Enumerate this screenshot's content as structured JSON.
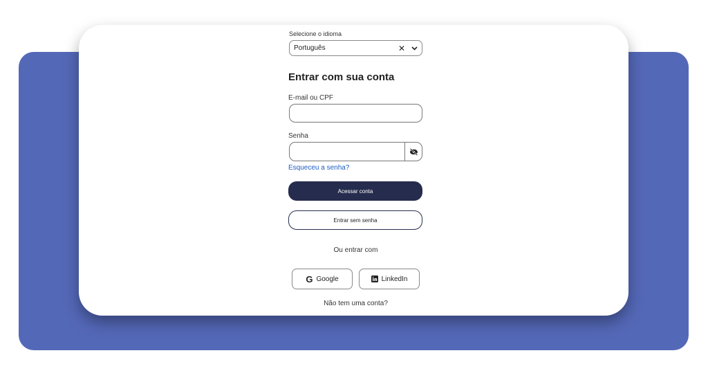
{
  "language": {
    "label": "Selecione o idioma",
    "selected": "Português",
    "clear_symbol": "✕"
  },
  "form": {
    "title": "Entrar com sua conta",
    "email_label": "E-mail ou CPF",
    "password_label": "Senha",
    "forgot_link": "Esqueceu a senha?",
    "submit_label": "Acessar conta",
    "passwordless_label": "Entrar sem senha"
  },
  "social": {
    "divider_text": "Ou entrar com",
    "google_label": "Google",
    "google_glyph": "G",
    "linkedin_label": "LinkedIn"
  },
  "footer": {
    "signup_prompt": "Não tem uma conta?"
  },
  "colors": {
    "background_panel": "#5468b8",
    "primary_button": "#262c4d",
    "link": "#1d5cc4"
  }
}
